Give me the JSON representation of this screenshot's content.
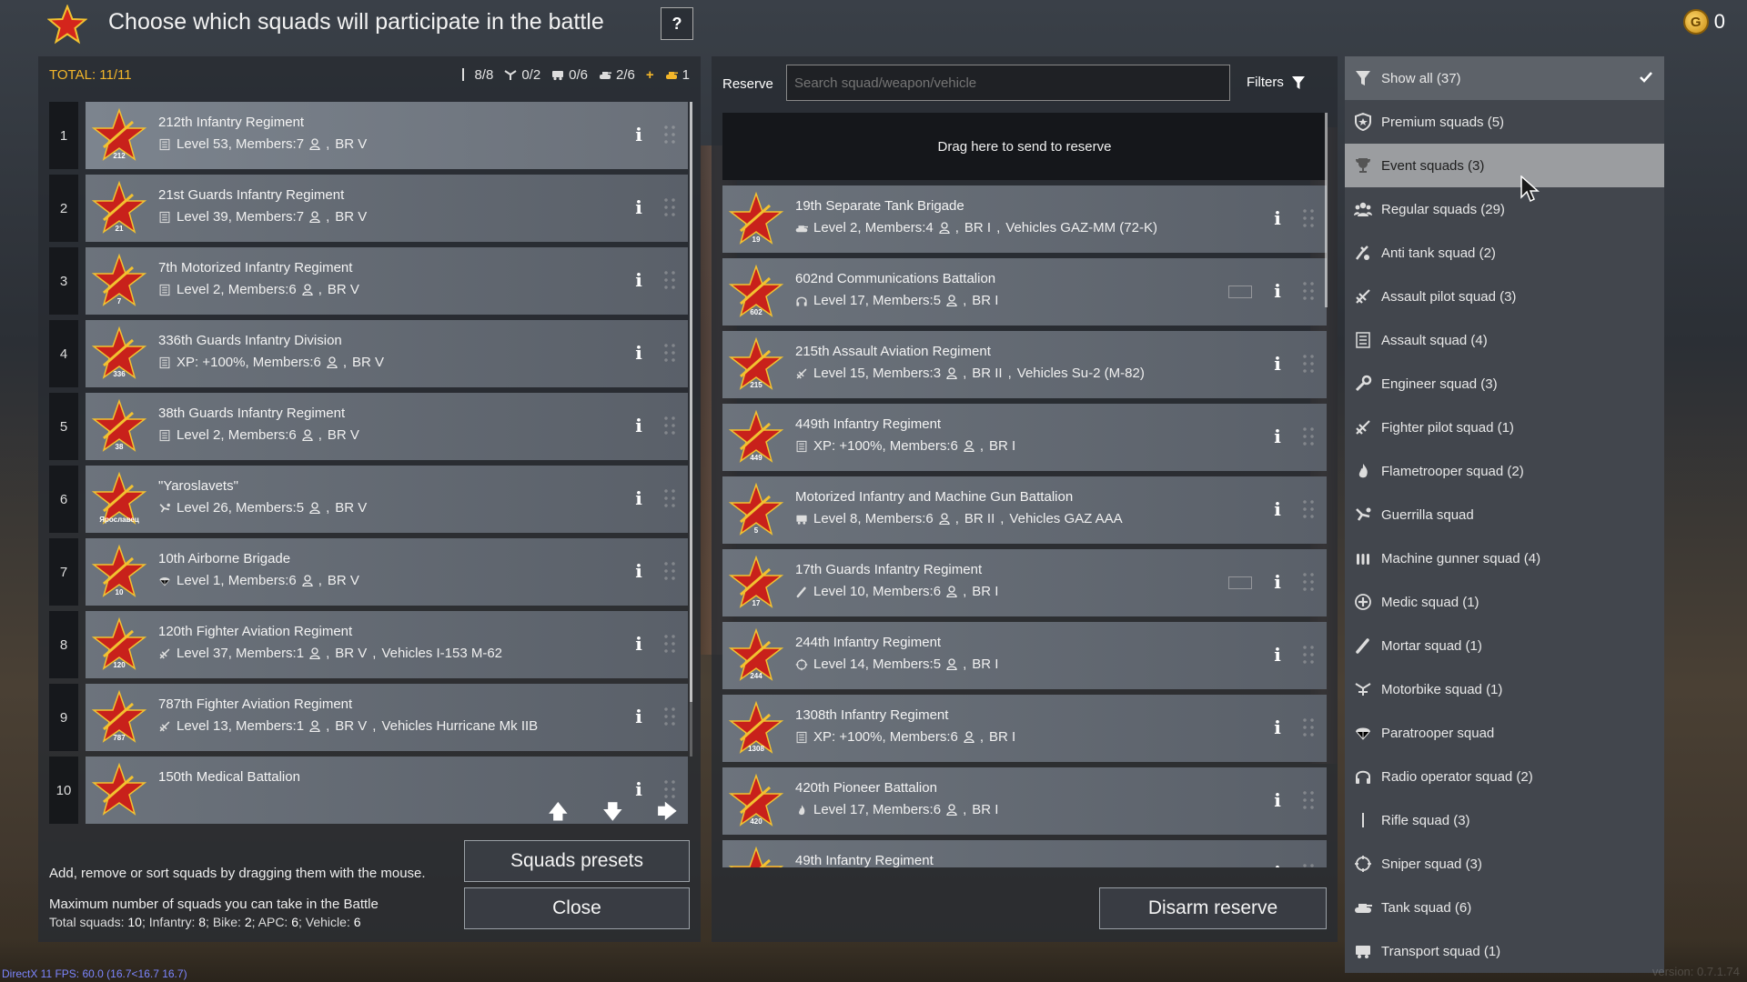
{
  "header": {
    "title": "Choose which squads will participate in the battle",
    "help_label": "?",
    "currency_value": "0",
    "coin_glyph": "G"
  },
  "left": {
    "total_label": "TOTAL: 11/11",
    "counts": {
      "infantry": "8/8",
      "bike": "0/2",
      "apc": "0/6",
      "vehicle": "2/6",
      "plus": "+",
      "extra": "1"
    },
    "squads": [
      {
        "num": "1",
        "name": "212th Infantry Regiment",
        "info": "Level 53, Members:7",
        "br": "BR V",
        "badge": "212",
        "type": "assault"
      },
      {
        "num": "2",
        "name": "21st Guards Infantry Regiment",
        "info": "Level 39, Members:7",
        "br": "BR V",
        "badge": "21",
        "type": "assault"
      },
      {
        "num": "3",
        "name": "7th Motorized Infantry Regiment",
        "info": "Level 2, Members:6",
        "br": "BR V",
        "badge": "7",
        "type": "assault"
      },
      {
        "num": "4",
        "name": "336th Guards Infantry Division",
        "info": "XP: +100%, Members:6",
        "br": "BR V",
        "badge": "336",
        "type": "assault"
      },
      {
        "num": "5",
        "name": "38th Guards Infantry Regiment",
        "info": "Level 2, Members:6",
        "br": "BR V",
        "badge": "38",
        "type": "assault"
      },
      {
        "num": "6",
        "name": "\"Yaroslavets\"",
        "info": "Level 26, Members:5",
        "br": "BR V",
        "badge": "Ярославец",
        "type": "guerrilla"
      },
      {
        "num": "7",
        "name": "10th Airborne Brigade",
        "info": "Level 1, Members:6",
        "br": "BR V",
        "badge": "10",
        "type": "paratrooper"
      },
      {
        "num": "8",
        "name": "120th Fighter Aviation Regiment",
        "info": "Level 37, Members:1",
        "br": "BR V",
        "vehicle": "Vehicles I-153 M-62",
        "badge": "120",
        "type": "pilot"
      },
      {
        "num": "9",
        "name": "787th Fighter Aviation Regiment",
        "info": "Level 13, Members:1",
        "br": "BR V",
        "vehicle": "Vehicles Hurricane Mk IIB",
        "badge": "787",
        "type": "pilot"
      },
      {
        "num": "10",
        "name": "150th Medical Battalion",
        "info": "",
        "br": "",
        "badge": "",
        "type": "medic"
      }
    ],
    "hint": "Add, remove or sort squads by dragging them with the mouse.",
    "max_title": "Maximum number of squads you can take in the Battle",
    "max_detail": {
      "total_label": "Total squads:",
      "total": "10",
      "inf_label": "Infantry:",
      "inf": "8",
      "bike_label": "Bike:",
      "bike": "2",
      "apc_label": "APC:",
      "apc": "6",
      "veh_label": "Vehicle:",
      "veh": "6"
    },
    "presets_label": "Squads presets",
    "close_label": "Close"
  },
  "reserve": {
    "label": "Reserve",
    "search_placeholder": "Search squad/weapon/vehicle",
    "filters_label": "Filters",
    "drop_zone": "Drag here to send to reserve",
    "squads": [
      {
        "name": "19th Separate Tank Brigade",
        "info": "Level 2, Members:4",
        "br": "BR I",
        "vehicle": "Vehicles GAZ-MM (72-K)",
        "badge": "19",
        "type": "tank"
      },
      {
        "name": "602nd Communications Battalion",
        "info": "Level 17, Members:5",
        "br": "BR I",
        "badge": "602",
        "type": "radio",
        "ab": true
      },
      {
        "name": "215th Assault Aviation Regiment",
        "info": "Level 15, Members:3",
        "br": "BR II",
        "vehicle": "Vehicles Su-2 (M-82)",
        "badge": "215",
        "type": "pilot"
      },
      {
        "name": "449th Infantry Regiment",
        "info": "XP: +100%, Members:6",
        "br": "BR I",
        "badge": "449",
        "type": "assault"
      },
      {
        "name": "Motorized Infantry and Machine Gun Battalion",
        "info": "Level 8, Members:6",
        "br": "BR II",
        "vehicle": "Vehicles GAZ AAA",
        "badge": "5",
        "type": "transport"
      },
      {
        "name": "17th Guards Infantry Regiment",
        "info": "Level 10, Members:6",
        "br": "BR I",
        "badge": "17",
        "type": "mortar",
        "ab": true
      },
      {
        "name": "244th Infantry Regiment",
        "info": "Level 14, Members:5",
        "br": "BR I",
        "badge": "244",
        "type": "sniper"
      },
      {
        "name": "1308th Infantry Regiment",
        "info": "XP: +100%, Members:6",
        "br": "BR I",
        "badge": "1308",
        "type": "assault"
      },
      {
        "name": "420th Pioneer Battalion",
        "info": "Level 17, Members:6",
        "br": "BR I",
        "badge": "420",
        "type": "flame"
      },
      {
        "name": "49th Infantry Regiment",
        "info": "",
        "br": "",
        "badge": "",
        "type": "assault"
      }
    ],
    "disarm_label": "Disarm reserve"
  },
  "filter_menu": [
    {
      "label": "Show all (37)",
      "icon": "funnel-icon",
      "state": "active"
    },
    {
      "label": "Premium squads (5)",
      "icon": "shield-icon",
      "state": ""
    },
    {
      "label": "Event squads (3)",
      "icon": "trophy-icon",
      "state": "hover"
    },
    {
      "label": "Regular squads (29)",
      "icon": "group-icon",
      "state": ""
    },
    {
      "label": "Anti tank squad (2)",
      "icon": "antitank-icon",
      "state": ""
    },
    {
      "label": "Assault pilot squad (3)",
      "icon": "plane-icon",
      "state": ""
    },
    {
      "label": "Assault squad (4)",
      "icon": "list-icon",
      "state": ""
    },
    {
      "label": "Engineer squad (3)",
      "icon": "wrench-icon",
      "state": ""
    },
    {
      "label": "Fighter pilot squad (1)",
      "icon": "plane-icon",
      "state": ""
    },
    {
      "label": "Flametrooper squad (2)",
      "icon": "flame-icon",
      "state": ""
    },
    {
      "label": "Guerrilla squad",
      "icon": "guerrilla-icon",
      "state": ""
    },
    {
      "label": "Machine gunner squad (4)",
      "icon": "ammo-icon",
      "state": ""
    },
    {
      "label": "Medic squad (1)",
      "icon": "medic-icon",
      "state": ""
    },
    {
      "label": "Mortar squad (1)",
      "icon": "mortar-icon",
      "state": ""
    },
    {
      "label": "Motorbike squad (1)",
      "icon": "motorbike-icon",
      "state": ""
    },
    {
      "label": "Paratrooper squad",
      "icon": "parachute-icon",
      "state": ""
    },
    {
      "label": "Radio operator squad (2)",
      "icon": "headset-icon",
      "state": ""
    },
    {
      "label": "Rifle squad (3)",
      "icon": "rifle-icon",
      "state": ""
    },
    {
      "label": "Sniper squad (3)",
      "icon": "crosshair-icon",
      "state": ""
    },
    {
      "label": "Tank squad (6)",
      "icon": "tank-icon",
      "state": ""
    },
    {
      "label": "Transport squad (1)",
      "icon": "truck-icon",
      "state": ""
    }
  ],
  "footer": {
    "fps": "DirectX 11 FPS: 60.0 (16.7<16.7 16.7)",
    "version": "version: 0.7.1.74"
  },
  "colors": {
    "accent": "#f3b62a",
    "emblem_red": "#c8211b",
    "emblem_gold": "#f2c230"
  }
}
